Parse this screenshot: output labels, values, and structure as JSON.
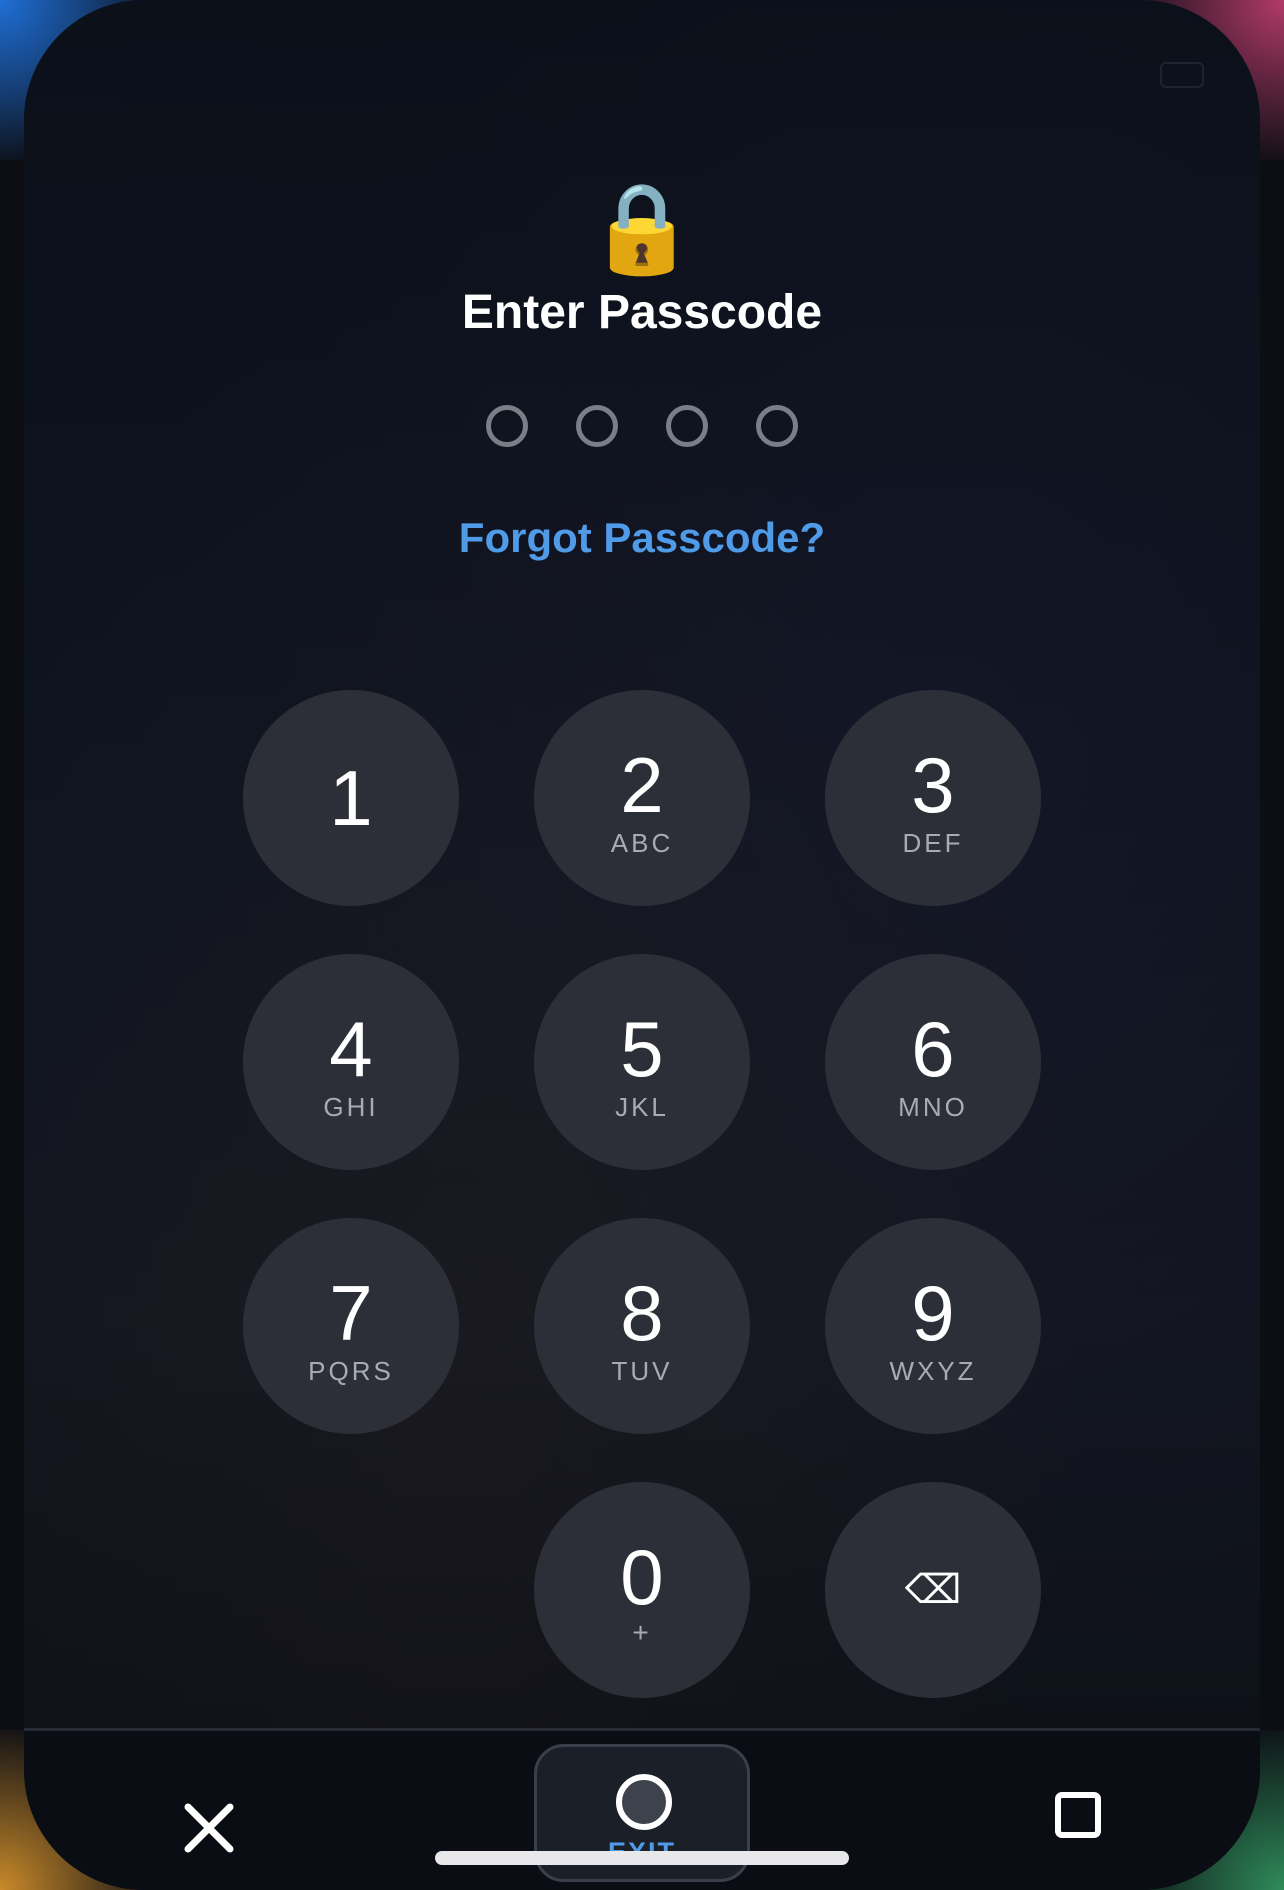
{
  "header": {
    "icon": "lock-icon",
    "icon_glyph": "🔒",
    "title": "Enter Passcode"
  },
  "passcode": {
    "length": 4,
    "entered": 0
  },
  "forgot_link": "Forgot Passcode?",
  "keypad": {
    "keys": [
      {
        "digit": "1",
        "letters": ""
      },
      {
        "digit": "2",
        "letters": "ABC"
      },
      {
        "digit": "3",
        "letters": "DEF"
      },
      {
        "digit": "4",
        "letters": "GHI"
      },
      {
        "digit": "5",
        "letters": "JKL"
      },
      {
        "digit": "6",
        "letters": "MNO"
      },
      {
        "digit": "7",
        "letters": "PQRS"
      },
      {
        "digit": "8",
        "letters": "TUV"
      },
      {
        "digit": "9",
        "letters": "WXYZ"
      },
      {
        "digit": "0",
        "letters": "+"
      }
    ],
    "backspace_glyph": "⌫",
    "backspace_icon": "backspace-icon"
  },
  "bottom_bar": {
    "close_icon": "close-icon",
    "exit_label": "EXIT",
    "exit_icon": "home-circle-icon",
    "recents_icon": "square-icon"
  },
  "colors": {
    "accent": "#4f9be8",
    "key_background": "#2c2f37",
    "background": "#0e1420"
  }
}
